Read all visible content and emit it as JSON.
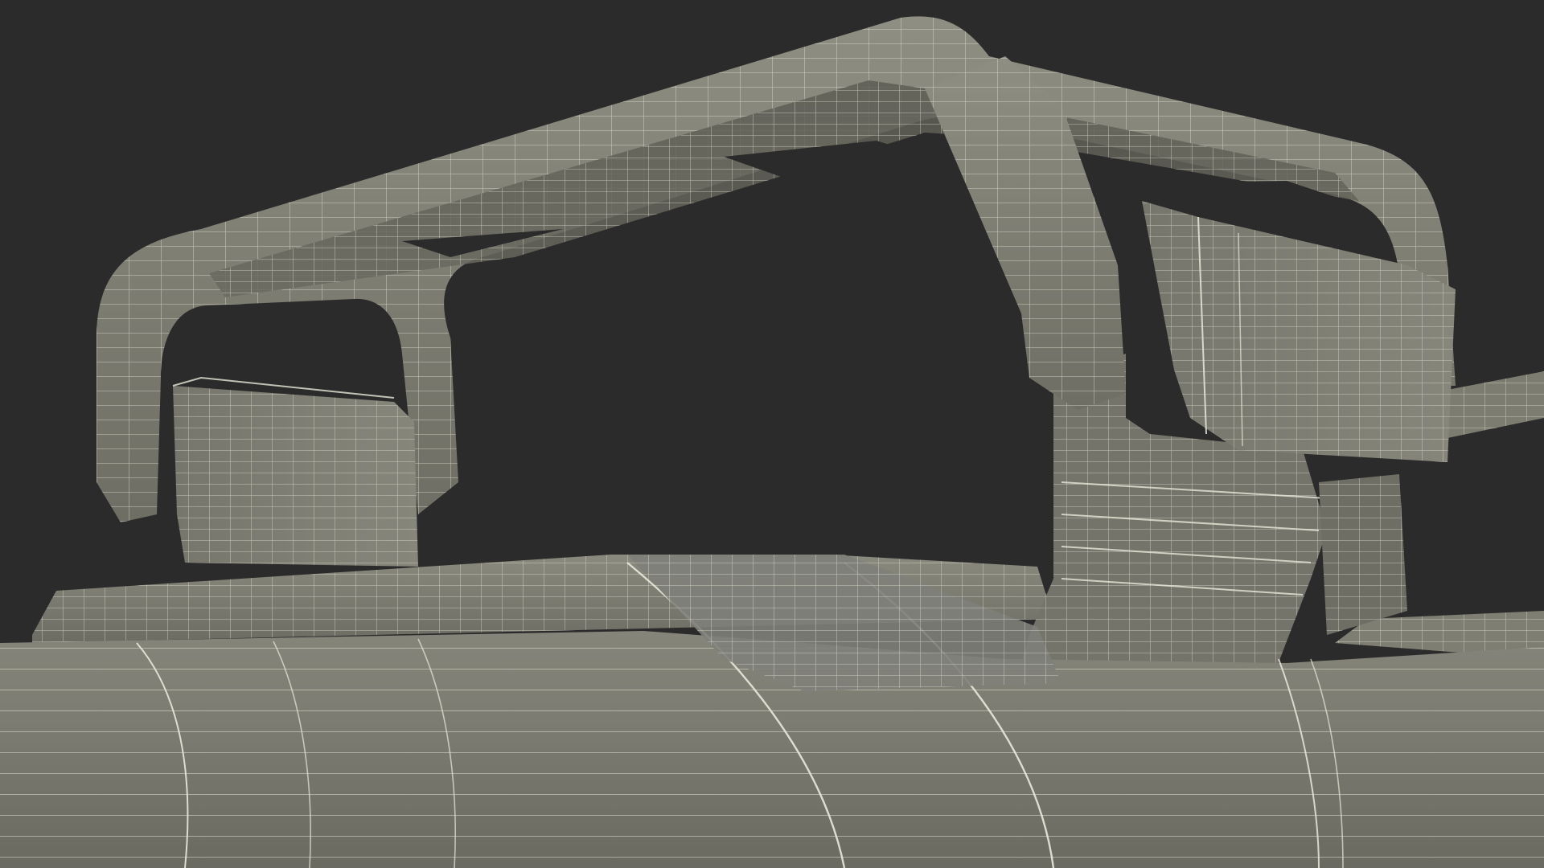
{
  "scene": {
    "subject": "wireframe-render",
    "colors": {
      "background": "#2b2b2b",
      "surface_light": "#8c8c80",
      "surface_mid": "#7a7a6e",
      "surface_dark": "#5e5e55",
      "surface_shadow": "#4a4a44",
      "wire": "#e8e8da"
    }
  }
}
